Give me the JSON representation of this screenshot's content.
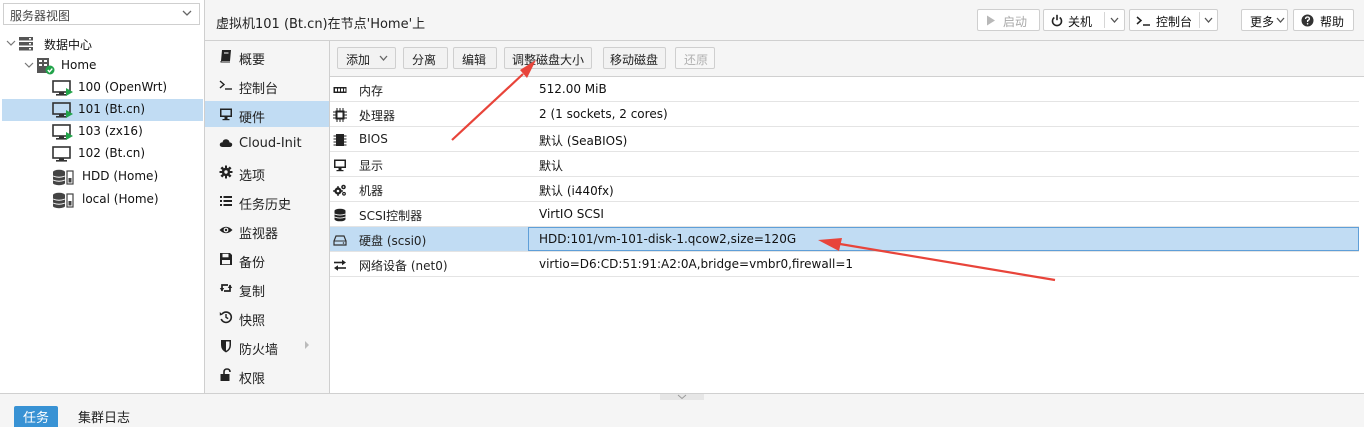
{
  "view_select": {
    "value": "服务器视图"
  },
  "tree": [
    {
      "label": "数据中心",
      "icon": "datacenter-icon"
    },
    {
      "label": "Home",
      "icon": "node-icon"
    },
    {
      "label": "100 (OpenWrt)",
      "icon": "vm-running-icon"
    },
    {
      "label": "101 (Bt.cn)",
      "icon": "vm-running-icon",
      "selected": true
    },
    {
      "label": "103 (zx16)",
      "icon": "vm-running-icon"
    },
    {
      "label": "102 (Bt.cn)",
      "icon": "vm-stopped-icon"
    },
    {
      "label": "HDD (Home)",
      "icon": "storage-icon"
    },
    {
      "label": "local (Home)",
      "icon": "storage-icon"
    }
  ],
  "header": {
    "title": "虚拟机101 (Bt.cn)在节点'Home'上",
    "start_label": "启动",
    "shutdown_label": "关机",
    "console_label": "控制台",
    "more_label": "更多",
    "help_label": "帮助"
  },
  "subnav": [
    {
      "label": "概要",
      "icon": "book-icon"
    },
    {
      "label": "控制台",
      "icon": "terminal-icon"
    },
    {
      "label": "硬件",
      "icon": "desktop-icon",
      "selected": true
    },
    {
      "label": "Cloud-Init",
      "icon": "cloud-icon"
    },
    {
      "label": "选项",
      "icon": "gear-icon"
    },
    {
      "label": "任务历史",
      "icon": "list-icon"
    },
    {
      "label": "监视器",
      "icon": "eye-icon"
    },
    {
      "label": "备份",
      "icon": "floppy-icon"
    },
    {
      "label": "复制",
      "icon": "retweet-icon"
    },
    {
      "label": "快照",
      "icon": "history-icon"
    },
    {
      "label": "防火墙",
      "icon": "shield-icon",
      "has_submenu": true
    },
    {
      "label": "权限",
      "icon": "unlock-icon"
    }
  ],
  "toolbar": {
    "add_label": "添加",
    "detach_label": "分离",
    "edit_label": "编辑",
    "resize_label": "调整磁盘大小",
    "move_label": "移动磁盘",
    "revert_label": "还原"
  },
  "hardware": [
    {
      "key": "内存",
      "value": "512.00 MiB",
      "icon": "memory-icon"
    },
    {
      "key": "处理器",
      "value": "2 (1 sockets, 2 cores)",
      "icon": "cpu-icon"
    },
    {
      "key": "BIOS",
      "value": "默认 (SeaBIOS)",
      "icon": "microchip-icon"
    },
    {
      "key": "显示",
      "value": "默认",
      "icon": "monitor-icon"
    },
    {
      "key": "机器",
      "value": "默认 (i440fx)",
      "icon": "cogs-icon"
    },
    {
      "key": "SCSI控制器",
      "value": "VirtIO SCSI",
      "icon": "database-icon"
    },
    {
      "key": "硬盘 (scsi0)",
      "value": "HDD:101/vm-101-disk-1.qcow2,size=120G",
      "icon": "hdd-icon",
      "selected": true
    },
    {
      "key": "网络设备 (net0)",
      "value": "virtio=D6:CD:51:91:A2:0A,bridge=vmbr0,firewall=1",
      "icon": "exchange-icon"
    }
  ],
  "bottom_tabs": {
    "tasks": "任务",
    "cluster_log": "集群日志"
  },
  "colors": {
    "selection": "#c1dcf3",
    "accent": "#3892d4",
    "annotation": "#e8443a",
    "running": "#22a34a"
  }
}
